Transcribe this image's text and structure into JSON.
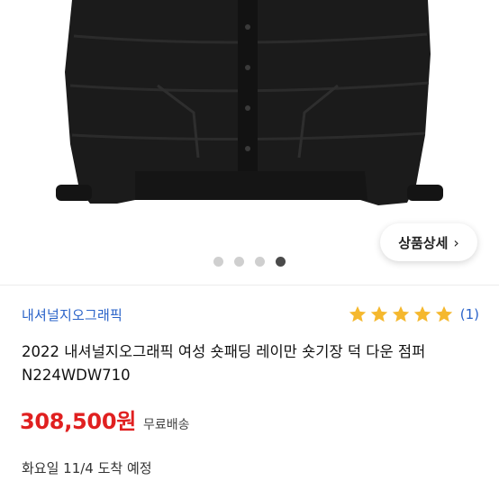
{
  "product_image": {
    "icon": "jacket-image"
  },
  "detail_button": {
    "label": "상품상세",
    "icon": "chevron-right-icon"
  },
  "carousel": {
    "count": 4,
    "active_index": 3
  },
  "brand": {
    "name": "내셔널지오그래픽"
  },
  "rating": {
    "stars": 5,
    "max_stars": 5,
    "count_text": "(1)",
    "star_color": "#f5b82e"
  },
  "product": {
    "title": "2022 내셔널지오그래픽 여성 숏패딩 레이만 숏기장 덕 다운 점퍼 N224WDW710"
  },
  "price": {
    "amount": "308,500원",
    "shipping": "무료배송",
    "color": "#e02020"
  },
  "delivery": {
    "text": "화요일 11/4 도착 예정"
  }
}
